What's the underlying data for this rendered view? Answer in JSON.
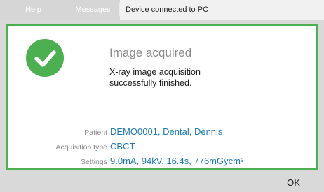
{
  "topbar": {
    "help_label": "Help",
    "messages_label": "Messages",
    "status_text": "Device connected to PC"
  },
  "dialog": {
    "icon": "checkmark-circle-icon",
    "title": "Image acquired",
    "message_lines": [
      "X-ray image acquisition",
      "successfully finished."
    ],
    "info": [
      {
        "label": "Patient",
        "value": "DEMO0001, Dental, Dennis"
      },
      {
        "label": "Acquisition type",
        "value": "CBCT"
      },
      {
        "label": "Settings",
        "value": "9.0mA, 94kV, 16.4s, 776mGycm²"
      }
    ]
  },
  "footer": {
    "ok_label": "OK"
  },
  "colors": {
    "accent_green": "#4caf50",
    "value_blue": "#1f7bb3",
    "label_gray": "#8a8a8a"
  }
}
